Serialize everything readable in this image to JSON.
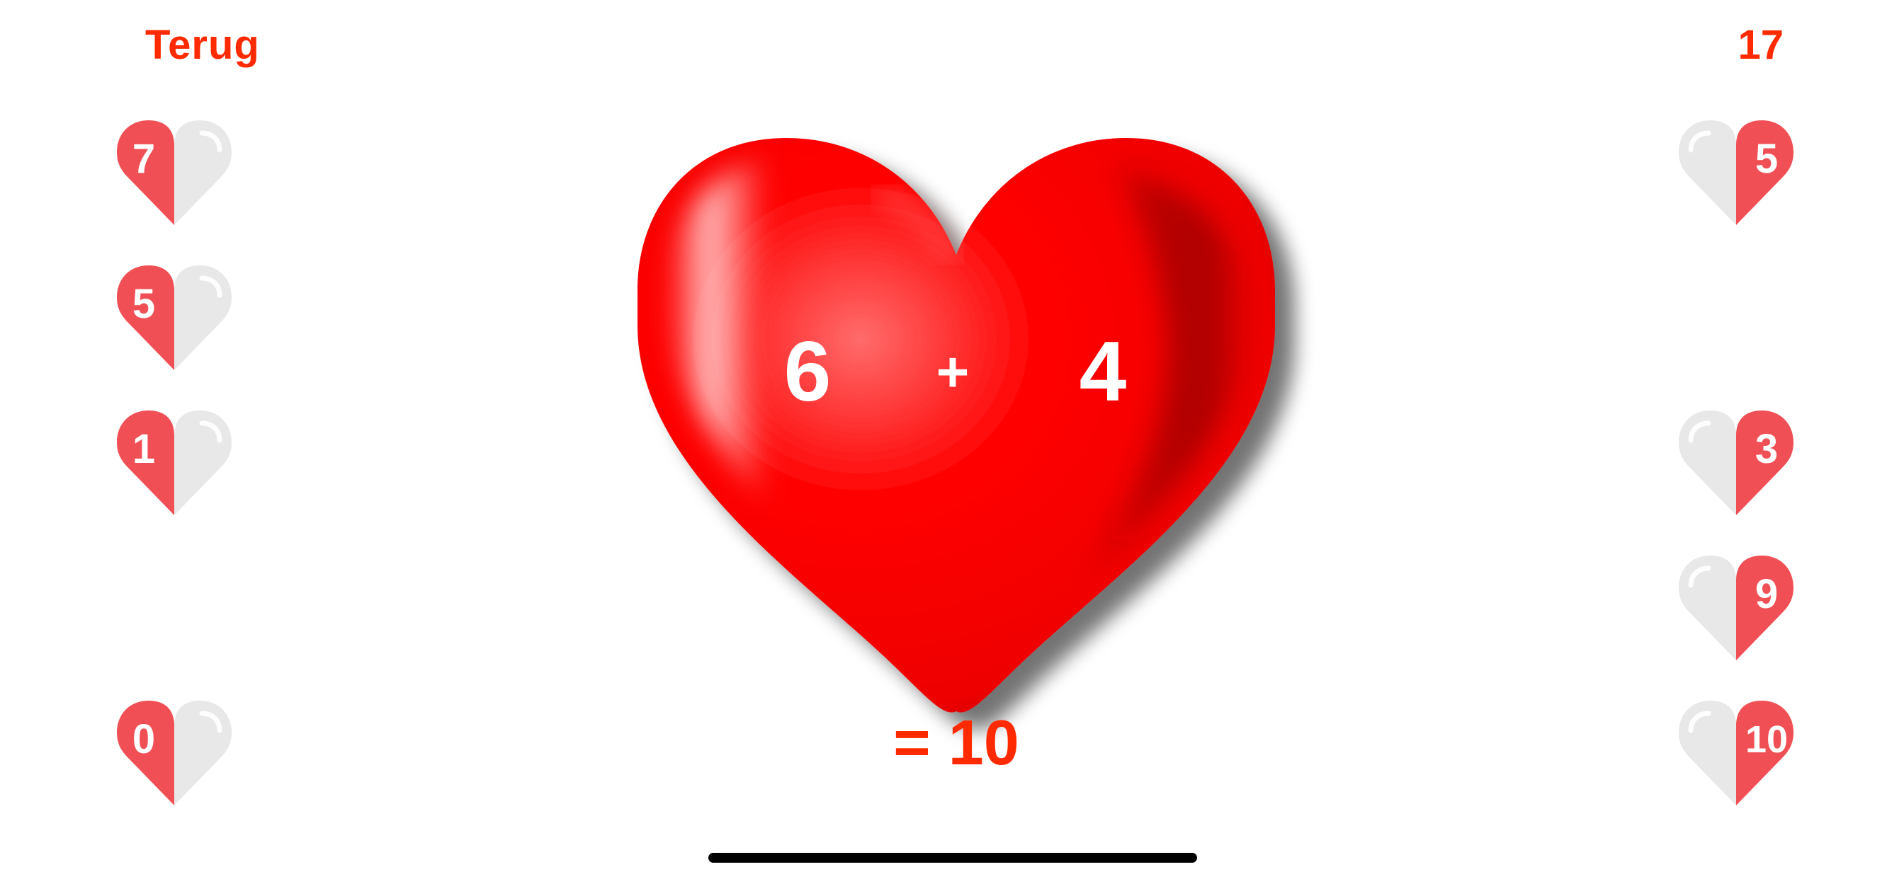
{
  "header": {
    "back_label": "Terug",
    "score": "17"
  },
  "equation": {
    "operand_a": "6",
    "operator": "+",
    "operand_b": "4",
    "result": "= 10"
  },
  "colors": {
    "accent": "#ff2a00",
    "heart_red": "#ff0000",
    "half_heart_red": "#f05055",
    "half_heart_grey": "#e8e8e8"
  },
  "left_hearts": [
    {
      "value": "7"
    },
    {
      "value": "5"
    },
    {
      "value": "1"
    },
    {
      "value": "0"
    }
  ],
  "right_hearts": [
    {
      "value": "5"
    },
    {
      "value": "3"
    },
    {
      "value": "9"
    },
    {
      "value": "10"
    }
  ],
  "icons": {
    "half_heart": "half-heart-icon",
    "big_heart": "heart-icon"
  }
}
